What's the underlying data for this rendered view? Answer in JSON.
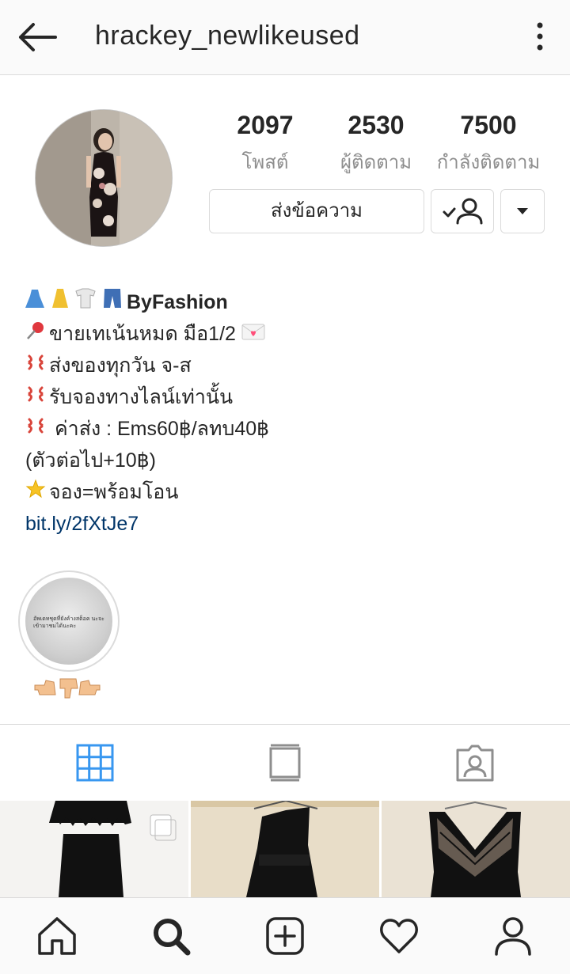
{
  "header": {
    "username": "hrackey_newlikeused",
    "back_icon": "arrow-left-icon",
    "more_icon": "more-vertical-icon"
  },
  "stats": [
    {
      "value": "2097",
      "label": "โพสต์"
    },
    {
      "value": "2530",
      "label": "ผู้ติดตาม"
    },
    {
      "value": "7500",
      "label": "กำลังติดตาม"
    }
  ],
  "actions": {
    "message_label": "ส่งข้อความ",
    "following_icon": "person-check-icon",
    "dropdown_icon": "caret-down-icon"
  },
  "bio": {
    "name": "ByFashion",
    "lines": [
      "ขายเทเน้นหมด มือ1/2",
      "ส่งของทุกวัน จ-ส",
      "รับจองทางไลน์เท่านั้น",
      " ค่าส่ง : Ems60฿/ลทบ40฿",
      "(ตัวต่อไป+10฿)",
      "จอง=พร้อมโอน"
    ],
    "link": "bit.ly/2fXtJe7"
  },
  "highlight": {
    "cover_text": "อัพเดทชุดที่ยังค้างสต็อค นะจะเข้ามาชมได้นะคะ",
    "label_icon": "pointing-hands-emoji"
  },
  "tabs": [
    {
      "icon": "grid-icon",
      "active": true
    },
    {
      "icon": "feed-list-icon",
      "active": false
    },
    {
      "icon": "tagged-person-icon",
      "active": false
    }
  ],
  "bottom_nav": [
    {
      "icon": "home-icon"
    },
    {
      "icon": "search-icon"
    },
    {
      "icon": "add-post-icon"
    },
    {
      "icon": "heart-icon"
    },
    {
      "icon": "profile-icon"
    }
  ],
  "colors": {
    "link": "#003569",
    "active_tab": "#3897f0",
    "secondary_text": "#8e8e8e",
    "border": "#dbdbdb"
  }
}
